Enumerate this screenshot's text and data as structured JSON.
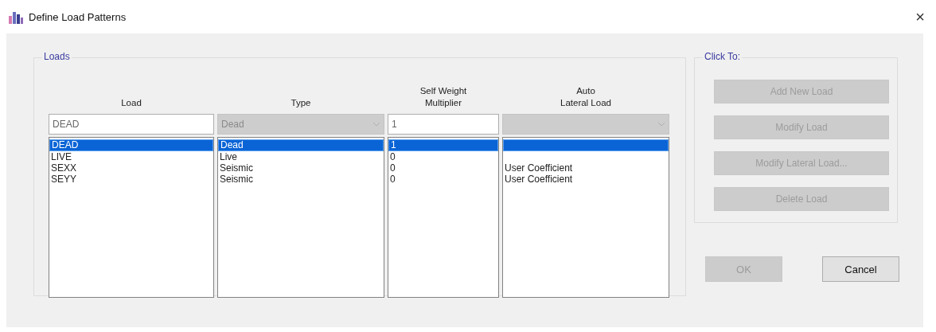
{
  "window": {
    "title": "Define Load Patterns",
    "close": "×"
  },
  "loads": {
    "title": "Loads",
    "columns": [
      {
        "heading": [
          "Load"
        ],
        "field": {
          "kind": "text",
          "value": "DEAD",
          "disabled": false
        }
      },
      {
        "heading": [
          "Type"
        ],
        "field": {
          "kind": "combo",
          "value": "Dead",
          "disabled": true
        }
      },
      {
        "heading": [
          "Self Weight",
          "Multiplier"
        ],
        "field": {
          "kind": "text",
          "value": "1",
          "disabled": false
        }
      },
      {
        "heading": [
          "Auto",
          "Lateral Load"
        ],
        "field": {
          "kind": "combo",
          "disabled": true
        }
      }
    ],
    "rows": [
      {
        "selected": true,
        "cells": [
          "DEAD",
          "Dead",
          "1",
          null
        ]
      },
      {
        "selected": false,
        "cells": [
          "LIVE",
          "Live",
          "0",
          null
        ]
      },
      {
        "selected": false,
        "cells": [
          "SEXX",
          "Seismic",
          "0",
          "User Coefficient"
        ]
      },
      {
        "selected": false,
        "cells": [
          "SEYY",
          "Seismic",
          "0",
          "User Coefficient"
        ]
      }
    ]
  },
  "click_to": {
    "title": "Click To:",
    "buttons": [
      {
        "label": "Add New Load",
        "disabled": true
      },
      {
        "label": "Modify Load",
        "disabled": true
      },
      {
        "label": "Modify Lateral Load...",
        "disabled": true
      },
      {
        "label": "Delete Load",
        "disabled": true
      }
    ]
  },
  "buttons": [
    {
      "label": "OK",
      "disabled": true
    },
    {
      "label": "Cancel",
      "disabled": false
    }
  ]
}
